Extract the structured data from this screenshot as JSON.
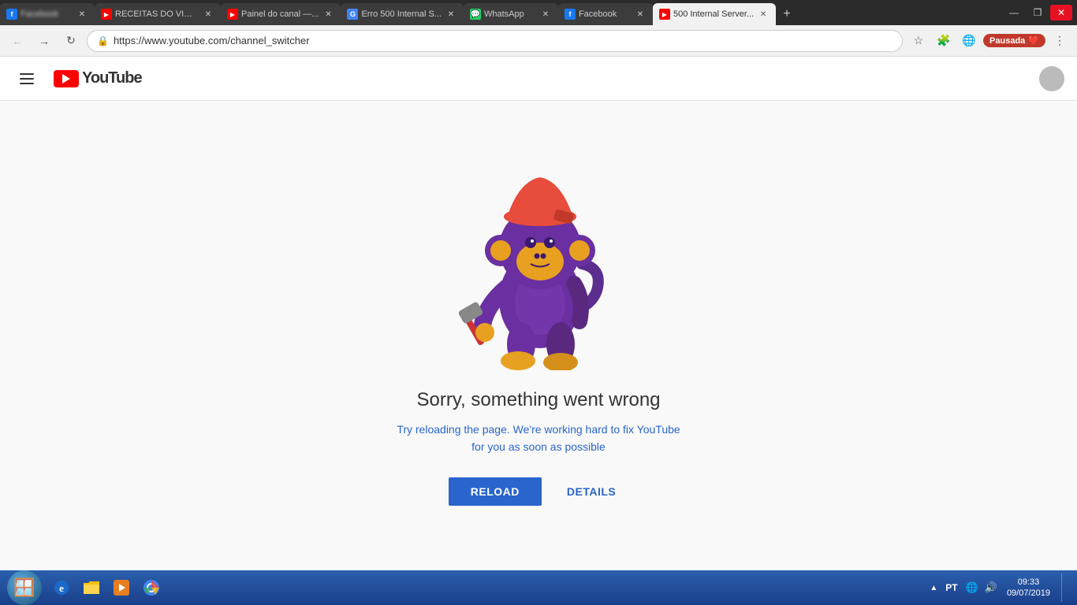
{
  "window": {
    "controls": {
      "minimize": "—",
      "maximize": "❐",
      "close": "✕"
    }
  },
  "tabs": [
    {
      "id": "tab1",
      "title": "Facebook",
      "favicon": "fb",
      "favicon_color": "#1877f2",
      "active": false
    },
    {
      "id": "tab2",
      "title": "RECEITAS DO VICT...",
      "favicon": "yt",
      "favicon_color": "#ff0000",
      "active": false
    },
    {
      "id": "tab3",
      "title": "Painel do canal —...",
      "favicon": "yt",
      "favicon_color": "#ff0000",
      "active": false
    },
    {
      "id": "tab4",
      "title": "Erro 500 Internal S...",
      "favicon": "g",
      "favicon_color": "#4285f4",
      "active": false
    },
    {
      "id": "tab5",
      "title": "WhatsApp",
      "favicon": "wa",
      "favicon_color": "#25d366",
      "active": false
    },
    {
      "id": "tab6",
      "title": "Facebook",
      "favicon": "fb",
      "favicon_color": "#1877f2",
      "active": false
    },
    {
      "id": "tab7",
      "title": "500 Internal Server...",
      "favicon": "yt",
      "favicon_color": "#ff0000",
      "active": true
    }
  ],
  "address_bar": {
    "url": "https://www.youtube.com/channel_switcher",
    "lock_icon": "🔒"
  },
  "header": {
    "menu_label": "Menu",
    "logo_text": "YouTube"
  },
  "error_page": {
    "title": "Sorry, something went wrong",
    "subtitle_line1": "Try reloading the page. We're working hard to fix YouTube",
    "subtitle_line2": "for you as soon as possible",
    "reload_button": "RELOAD",
    "details_button": "DETAILS"
  },
  "taskbar": {
    "time": "09:33",
    "date": "09/07/2019",
    "language": "PT",
    "icons": [
      "🌐",
      "📁",
      "▶"
    ]
  }
}
